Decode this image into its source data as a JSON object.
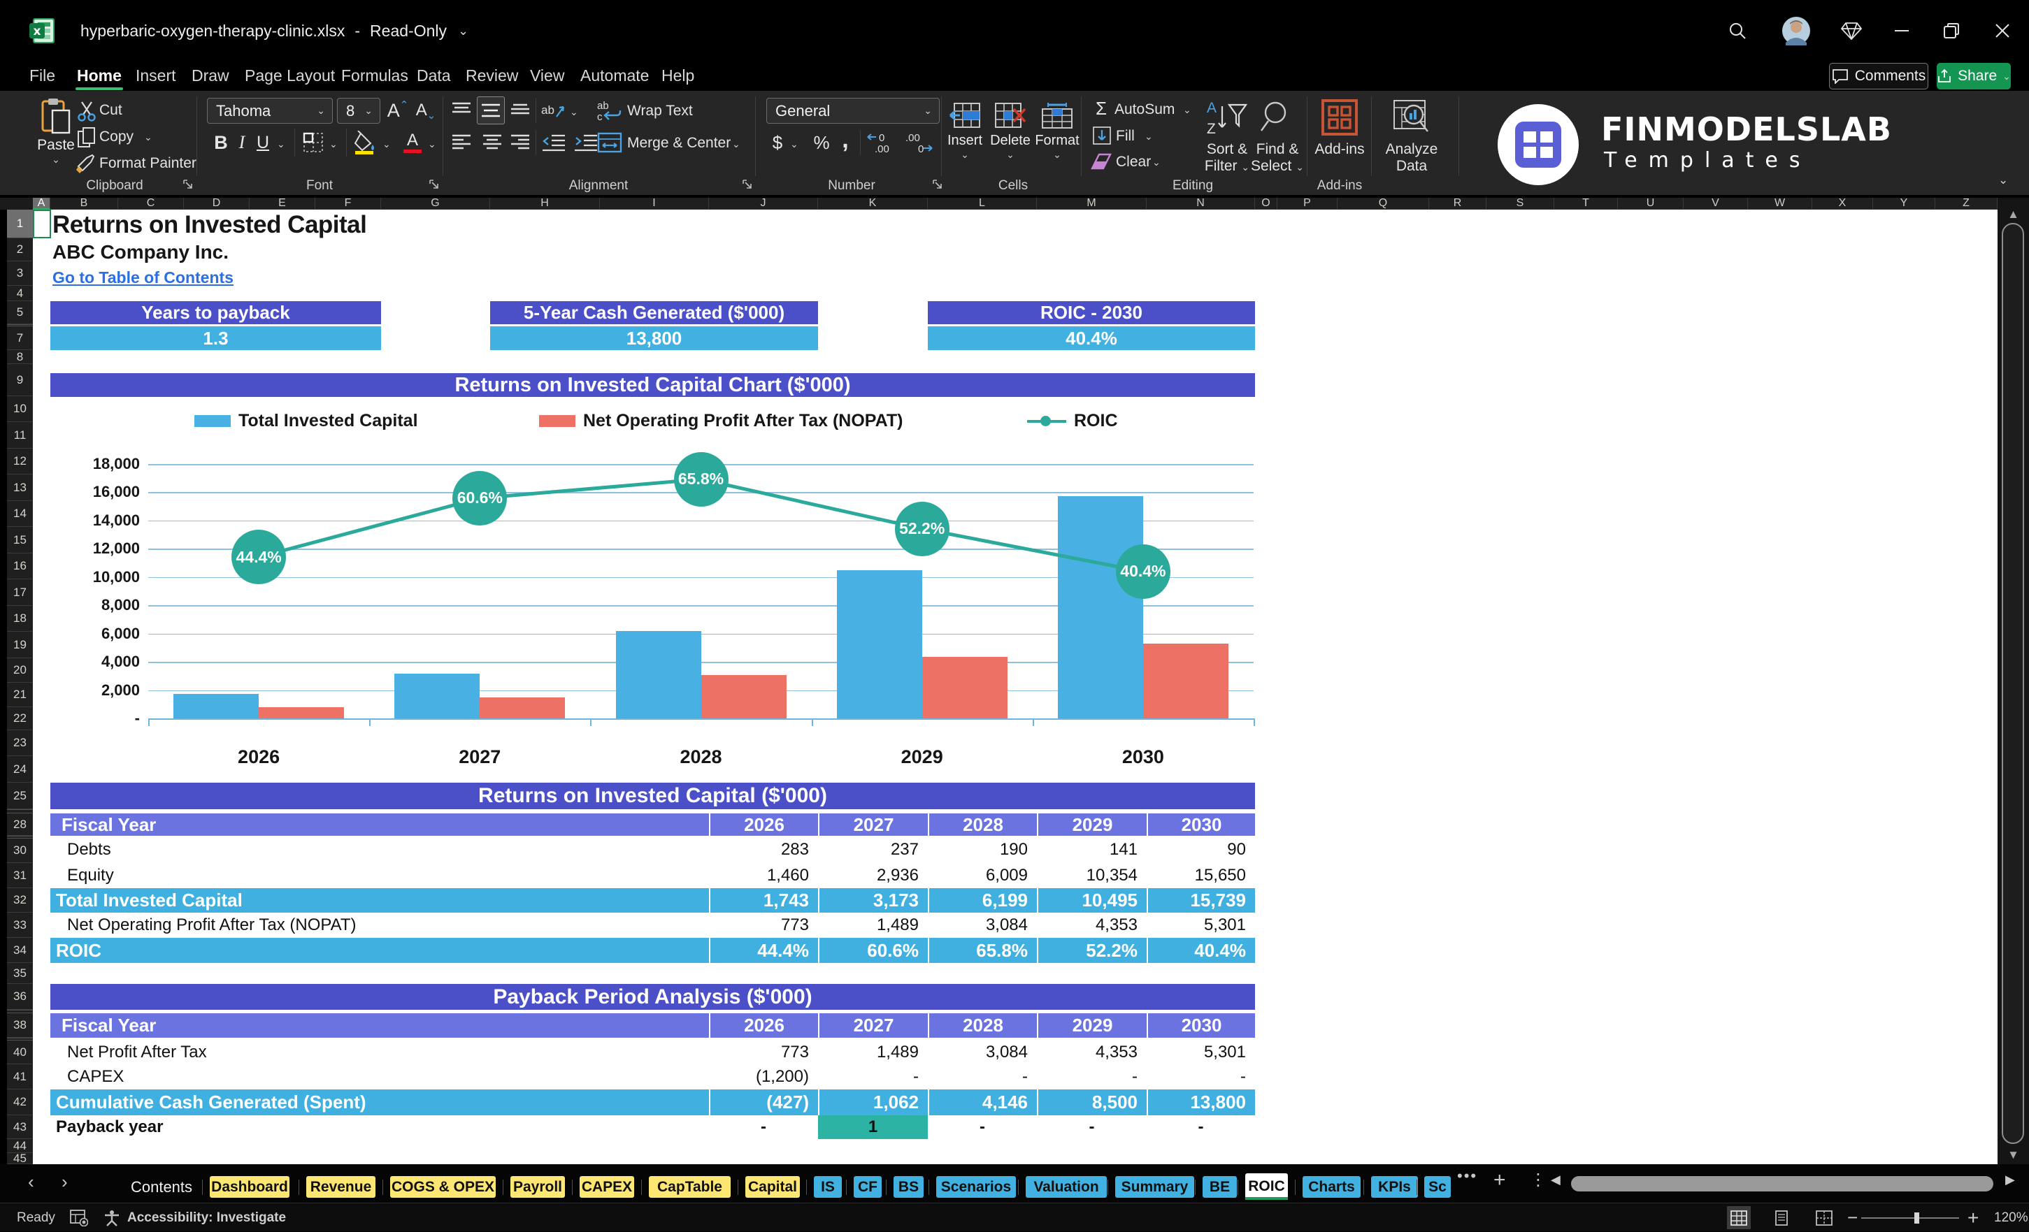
{
  "colors": {
    "purple_header": "#4b50c9",
    "purple_light": "#6a73df",
    "blue_fill": "#41b1e1",
    "chart_bar_blue": "#49b0e4",
    "chart_bar_red": "#ed7165",
    "teal": "#2baa9b",
    "teal_chip": "#2cb3a3",
    "tab_yellow": "#fde671",
    "tab_blue": "#41b1e1",
    "excel_green": "#1e9e5a",
    "link_blue": "#2b6fe3"
  },
  "titlebar": {
    "filename": "hyperbaric-oxygen-therapy-clinic.xlsx",
    "dash": "-",
    "mode": "Read-Only",
    "icons": [
      "search",
      "avatar",
      "gem",
      "minimize",
      "restore",
      "close"
    ]
  },
  "ribbon_tabs": [
    {
      "label": "File",
      "active": false
    },
    {
      "label": "Home",
      "active": true
    },
    {
      "label": "Insert",
      "active": false
    },
    {
      "label": "Draw",
      "active": false
    },
    {
      "label": "Page Layout",
      "active": false
    },
    {
      "label": "Formulas",
      "active": false
    },
    {
      "label": "Data",
      "active": false
    },
    {
      "label": "Review",
      "active": false
    },
    {
      "label": "View",
      "active": false
    },
    {
      "label": "Automate",
      "active": false
    },
    {
      "label": "Help",
      "active": false
    }
  ],
  "top_actions": {
    "comments": "Comments",
    "share": "Share"
  },
  "ribbon": {
    "clipboard": {
      "label": "Clipboard",
      "paste": "Paste",
      "cut": "Cut",
      "copy": "Copy",
      "format_painter": "Format Painter"
    },
    "font": {
      "label": "Font",
      "family": "Tahoma",
      "size": "8"
    },
    "alignment": {
      "label": "Alignment",
      "wrap": "Wrap Text",
      "merge": "Merge & Center"
    },
    "number": {
      "label": "Number",
      "format": "General"
    },
    "cells": {
      "label": "Cells",
      "insert": "Insert",
      "del": "Delete",
      "format": "Format"
    },
    "editing": {
      "label": "Editing",
      "autosum": "AutoSum",
      "fill": "Fill",
      "clear": "Clear",
      "sort1": "Sort &",
      "sort2": "Filter",
      "find1": "Find &",
      "find2": "Select"
    },
    "addins": {
      "label": "Add-ins",
      "addins": "Add-ins",
      "analyze1": "Analyze",
      "analyze2": "Data"
    }
  },
  "logo": {
    "line1": "FINMODELSLAB",
    "line2": "Templates"
  },
  "grid": {
    "columns": [
      "A",
      "B",
      "C",
      "D",
      "E",
      "F",
      "G",
      "H",
      "I",
      "J",
      "K",
      "L",
      "M",
      "N",
      "O",
      "P",
      "Q",
      "R",
      "S",
      "T",
      "U",
      "V",
      "W",
      "X",
      "Y",
      "Z"
    ],
    "selected_column": "A",
    "rows": [
      1,
      2,
      3,
      4,
      5,
      7,
      8,
      9,
      10,
      11,
      12,
      13,
      14,
      15,
      16,
      17,
      18,
      19,
      20,
      21,
      22,
      23,
      24,
      25,
      28,
      30,
      31,
      32,
      33,
      34,
      35,
      36,
      38,
      40,
      41,
      42,
      43,
      44,
      45
    ],
    "selected_row": 1
  },
  "sheet": {
    "title": "Returns on Invested Capital",
    "subtitle": "ABC Company Inc.",
    "link": "Go to Table of Contents",
    "kpis": [
      {
        "label": "Years to payback",
        "value": "1.3"
      },
      {
        "label": "5-Year Cash Generated ($'000)",
        "value": "13,800"
      },
      {
        "label": "ROIC - 2030",
        "value": "40.4%"
      }
    ]
  },
  "chart_data": {
    "type": "bar",
    "title": "Returns on Invested Capital Chart ($'000)",
    "categories": [
      "2026",
      "2027",
      "2028",
      "2029",
      "2030"
    ],
    "series": [
      {
        "name": "Total Invested Capital",
        "type": "bar",
        "values": [
          1743,
          3173,
          6199,
          10495,
          15739
        ]
      },
      {
        "name": "Net Operating Profit After Tax (NOPAT)",
        "type": "bar",
        "values": [
          773,
          1489,
          3084,
          4353,
          5301
        ]
      },
      {
        "name": "ROIC",
        "type": "line",
        "axis": "secondary",
        "values": [
          44.4,
          60.6,
          65.8,
          52.2,
          40.4
        ],
        "labels": [
          "44.4%",
          "60.6%",
          "65.8%",
          "52.2%",
          "40.4%"
        ]
      }
    ],
    "ylim": [
      0,
      18000
    ],
    "ytick_step": 2000,
    "ytick_labels": [
      "-",
      "2,000",
      "4,000",
      "6,000",
      "8,000",
      "10,000",
      "12,000",
      "14,000",
      "16,000",
      "18,000"
    ],
    "y2lim": [
      0,
      70
    ],
    "legend_position": "top",
    "grid": true
  },
  "tables": [
    {
      "title": "Returns on Invested Capital ($'000)",
      "header_label": "Fiscal Year",
      "years": [
        "2026",
        "2027",
        "2028",
        "2029",
        "2030"
      ],
      "rows": [
        {
          "label": "Debts",
          "style": "plain",
          "values": [
            "283",
            "237",
            "190",
            "141",
            "90"
          ]
        },
        {
          "label": "Equity",
          "style": "plain",
          "values": [
            "1,460",
            "2,936",
            "6,009",
            "10,354",
            "15,650"
          ]
        },
        {
          "label": "Total Invested Capital",
          "style": "highlight",
          "values": [
            "1,743",
            "3,173",
            "6,199",
            "10,495",
            "15,739"
          ]
        },
        {
          "label": "Net Operating Profit After Tax (NOPAT)",
          "style": "plain",
          "values": [
            "773",
            "1,489",
            "3,084",
            "4,353",
            "5,301"
          ]
        },
        {
          "label": "ROIC",
          "style": "highlight",
          "values": [
            "44.4%",
            "60.6%",
            "65.8%",
            "52.2%",
            "40.4%"
          ]
        }
      ]
    },
    {
      "title": "Payback Period Analysis ($'000)",
      "header_label": "Fiscal Year",
      "years": [
        "2026",
        "2027",
        "2028",
        "2029",
        "2030"
      ],
      "rows": [
        {
          "label": "Net Profit After Tax",
          "style": "plain",
          "values": [
            "773",
            "1,489",
            "3,084",
            "4,353",
            "5,301"
          ]
        },
        {
          "label": "CAPEX",
          "style": "plain",
          "values": [
            "(1,200)",
            "-",
            "-",
            "-",
            "-"
          ]
        },
        {
          "label": "Cumulative Cash Generated (Spent)",
          "style": "highlight",
          "values": [
            "(427)",
            "1,062",
            "4,146",
            "8,500",
            "13,800"
          ]
        },
        {
          "label": "Payback year",
          "style": "payback",
          "values": [
            "-",
            "1",
            "-",
            "-",
            "-"
          ],
          "highlight_index": 1
        }
      ]
    }
  ],
  "sheet_tabs": [
    {
      "label": "Contents",
      "style": "plain"
    },
    {
      "label": "Dashboard",
      "style": "yellow"
    },
    {
      "label": "Revenue",
      "style": "yellow"
    },
    {
      "label": "COGS & OPEX",
      "style": "yellow"
    },
    {
      "label": "Payroll",
      "style": "yellow"
    },
    {
      "label": "CAPEX",
      "style": "yellow"
    },
    {
      "label": "CapTable",
      "style": "yellow"
    },
    {
      "label": "Capital",
      "style": "yellow"
    },
    {
      "label": "IS",
      "style": "blue"
    },
    {
      "label": "CF",
      "style": "blue"
    },
    {
      "label": "BS",
      "style": "blue"
    },
    {
      "label": "Scenarios",
      "style": "blue"
    },
    {
      "label": "Valuation",
      "style": "blue"
    },
    {
      "label": "Summary",
      "style": "blue"
    },
    {
      "label": "BE",
      "style": "blue"
    },
    {
      "label": "ROIC",
      "style": "active"
    },
    {
      "label": "Charts",
      "style": "blue"
    },
    {
      "label": "KPIs",
      "style": "blue"
    },
    {
      "label": "Sc",
      "style": "blue"
    }
  ],
  "statusbar": {
    "ready": "Ready",
    "accessibility": "Accessibility: Investigate",
    "zoom": "120%"
  }
}
